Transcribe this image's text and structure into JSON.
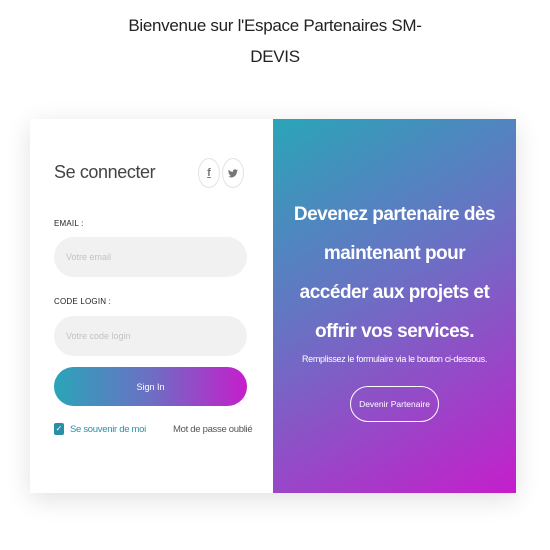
{
  "header": {
    "title_line1": "Bienvenue sur l'Espace Partenaires SM-",
    "title_line2": "DEVIS"
  },
  "login": {
    "title": "Se connecter",
    "social": [
      {
        "icon": "facebook-icon",
        "glyph": "f"
      },
      {
        "icon": "twitter-icon",
        "glyph": "🐦"
      }
    ],
    "email_label": "EMAIL :",
    "email_placeholder": "Votre email",
    "code_label": "CODE LOGIN :",
    "code_placeholder": "Votre code login",
    "signin_label": "Sign In",
    "remember_label": "Se souvenir de moi",
    "remember_checked": true,
    "forgot_label": "Mot de passe oublié"
  },
  "promo": {
    "headline_lines": [
      "Devenez partenaire dès",
      "maintenant pour",
      "accéder aux projets et",
      "offrir vos services."
    ],
    "subtitle": "Remplissez le formulaire via le bouton ci-dessous.",
    "button_label": "Devenir Partenaire"
  },
  "colors": {
    "gradient_start": "#2aa5b8",
    "gradient_mid": "#6c6fc4",
    "gradient_end": "#c51ecb",
    "accent": "#2a8fa6"
  }
}
